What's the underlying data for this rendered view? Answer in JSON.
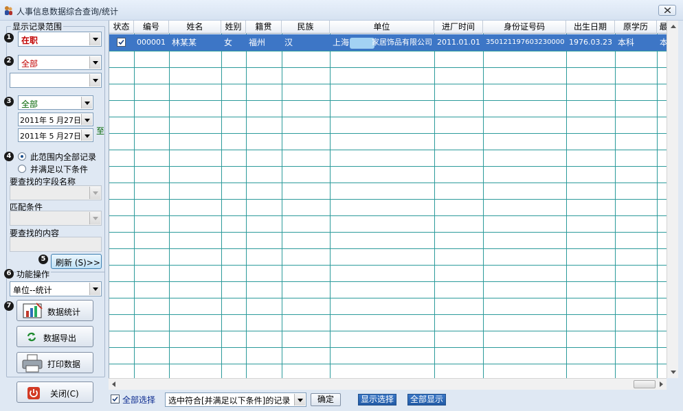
{
  "window": {
    "title": "人事信息数据综合查询/统计"
  },
  "filters": {
    "group_title": "显示记录范围",
    "step_numbers": [
      "1",
      "2",
      "3",
      "4",
      "5",
      "6",
      "7"
    ],
    "status_value": "在职",
    "dept_value": "全部",
    "dept_sub_value": "",
    "date_type_value": "全部",
    "date_from": "2011年 5 月27日",
    "date_to": "2011年 5 月27日",
    "date_to_label": "至",
    "radio_all_label": "此范围内全部记录",
    "radio_cond_label": "并满足以下条件",
    "field_name_label": "要查找的字段名称",
    "match_label": "匹配条件",
    "content_label": "要查找的内容",
    "refresh_label": "刷新 (S)>>"
  },
  "functions": {
    "title": "功能操作",
    "operation_value": "单位--统计",
    "stats_label": "数据统计",
    "export_label": "数据导出",
    "print_label": "打印数据",
    "close_label": "关闭(C)"
  },
  "grid": {
    "columns": [
      "状态",
      "编号",
      "姓名",
      "姓别",
      "籍贯",
      "民族",
      "单位",
      "进厂时间",
      "身份证号码",
      "出生日期",
      "原学历",
      "最"
    ],
    "rows": [
      {
        "checked": true,
        "id": "000001",
        "name": "林某某",
        "gender": "女",
        "hometown": "福州",
        "ethnicity": "汉",
        "unit_prefix": "上海",
        "unit_suffix": "家居饰品有限公司",
        "join_date": "2011.01.01",
        "id_number": "350121197603230000",
        "birth_date": "1976.03.23",
        "education": "本科",
        "last": "本"
      }
    ]
  },
  "bottom": {
    "select_all_label": "全部选择",
    "select_combo_value": "选中符合[并满足以下条件]的记录",
    "ok_label": "确定",
    "show_selected_label": "显示选择",
    "show_all_label": "全部显示"
  },
  "colors": {
    "selected_row": "#3d76c6",
    "grid_line": "#2a9a9a",
    "status_value": "#c00000",
    "dept_value": "#c00000",
    "date_type_value": "#006400"
  }
}
